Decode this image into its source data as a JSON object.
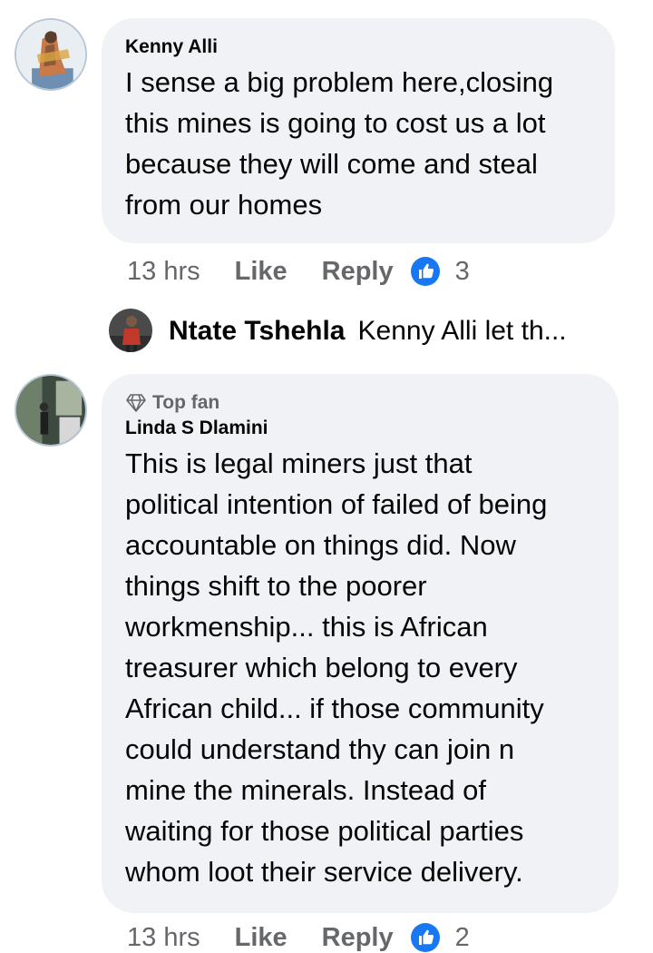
{
  "comments": [
    {
      "author": "Kenny Alli",
      "text": "I sense a big problem here,closing\nthis mines is going to cost us a lot\nbecause they will come and steal\nfrom our homes",
      "time": "13 hrs",
      "like_label": "Like",
      "reply_label": "Reply",
      "reaction_icon": "thumbs-up-icon",
      "reaction_count": "3",
      "reply_preview": {
        "author": "Ntate Tshehla",
        "text": "Kenny Alli let th..."
      }
    },
    {
      "badge": "Top fan",
      "badge_icon": "diamond-icon",
      "author": "Linda S Dlamini",
      "text": "This is legal miners just that\npolitical intention of failed of being\naccountable on things did. Now\nthings shift to the poorer\nworkmenship... this is African\ntreasurer which belong to every\nAfrican child... if those community\ncould understand thy can join n\nmine the minerals. Instead of\nwaiting for those political parties\nwhom loot their service delivery.",
      "time": "13 hrs",
      "like_label": "Like",
      "reply_label": "Reply",
      "reaction_icon": "thumbs-up-icon",
      "reaction_count": "2"
    }
  ],
  "colors": {
    "bubble_bg": "#f0f2f5",
    "meta_text": "#65676b",
    "like_blue": "#1877f2"
  }
}
